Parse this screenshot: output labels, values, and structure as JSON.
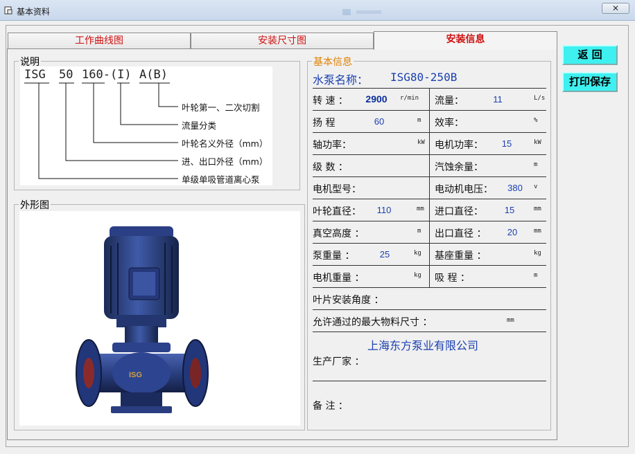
{
  "window": {
    "title": "基本资料",
    "close_label": "✕"
  },
  "tabs": [
    {
      "label": "工作曲线图"
    },
    {
      "label": "安装尺寸图"
    },
    {
      "label": "安装信息"
    }
  ],
  "explain": {
    "title": "说明",
    "model_parts": [
      "ISG",
      "50",
      "160-(I)",
      "A(B)"
    ],
    "descriptions": [
      "叶轮第一、二次切割",
      "流量分类",
      "叶轮名义外径（mm）",
      "进、出口外径（mm）",
      "单级单吸管道离心泵"
    ]
  },
  "appearance": {
    "title": "外形图"
  },
  "info": {
    "title": "基本信息",
    "pump_name_label": "水泵名称：",
    "pump_name": "ISG80-250B",
    "speed_label": "转  速 ：",
    "speed": "2900",
    "speed_unit": "r/min",
    "flow_label": "流量：",
    "flow": "11",
    "flow_unit": "L/s",
    "head_label": "扬 程",
    "head": "60",
    "head_unit": "m",
    "eff_label": "效率：",
    "eff_unit": "%",
    "shaft_power_label": "轴功率：",
    "shaft_power_unit": "kW",
    "motor_power_label": "电机功率：",
    "motor_power": "15",
    "motor_power_unit": "kW",
    "stages_label": "级  数 ：",
    "npsh_label": "汽蚀余量：",
    "npsh_unit": "m",
    "motor_model_label": "电机型号：",
    "motor_voltage_label": "电动机电压：",
    "motor_voltage": "380",
    "motor_voltage_unit": "v",
    "impeller_dia_label": "叶轮直径：",
    "impeller_dia": "110",
    "impeller_dia_unit": "mm",
    "inlet_dia_label": "进口直径：",
    "inlet_dia": "15",
    "inlet_dia_unit": "mm",
    "vacuum_label": "真空高度 ：",
    "vacuum_unit": "m",
    "outlet_dia_label": "出口直径 ：",
    "outlet_dia": "20",
    "outlet_dia_unit": "mm",
    "pump_weight_label": "泵重量 ：",
    "pump_weight": "25",
    "pump_weight_unit": "kg",
    "base_weight_label": "基座重量 ：",
    "base_weight_unit": "kg",
    "motor_weight_label": "电机重量 ：",
    "motor_weight_unit": "kg",
    "suction_label": "吸  程 ：",
    "suction_unit": "m",
    "blade_angle_label": "叶片安装角度 ：",
    "max_particle_label": "允许通过的最大物料尺寸 ：",
    "max_particle_unit": "mm",
    "manufacturer_label": "生产厂家 ：",
    "manufacturer": "上海东方泵业有限公司",
    "remarks_label": "备  注 ："
  },
  "buttons": {
    "back": "返  回",
    "print_save": "打印保存"
  },
  "colors": {
    "tab_text": "#d01010",
    "value_blue": "#1a3fb0",
    "button_cyan": "#3ef0f0",
    "legend_orange": "#e08000"
  }
}
